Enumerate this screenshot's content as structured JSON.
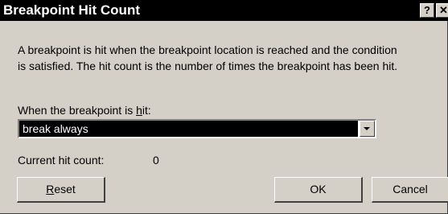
{
  "window": {
    "title": "Breakpoint Hit Count",
    "help_glyph": "?",
    "close_glyph": "✕"
  },
  "description": {
    "line1": "A breakpoint is hit when the breakpoint location is reached and the condition",
    "line2": "is satisfied. The hit count is the number of times the breakpoint has been hit."
  },
  "when_label": {
    "prefix": "When the breakpoint is ",
    "accel": "h",
    "suffix": "it:"
  },
  "condition_select": {
    "selected": "break always"
  },
  "hit_count": {
    "label": "Current hit count:",
    "value": "0"
  },
  "buttons": {
    "reset_accel": "R",
    "reset_rest": "eset",
    "ok": "OK",
    "cancel": "Cancel"
  },
  "colors": {
    "titlebar": "#000000",
    "face": "#d4d0c8",
    "selection": "#000000"
  }
}
